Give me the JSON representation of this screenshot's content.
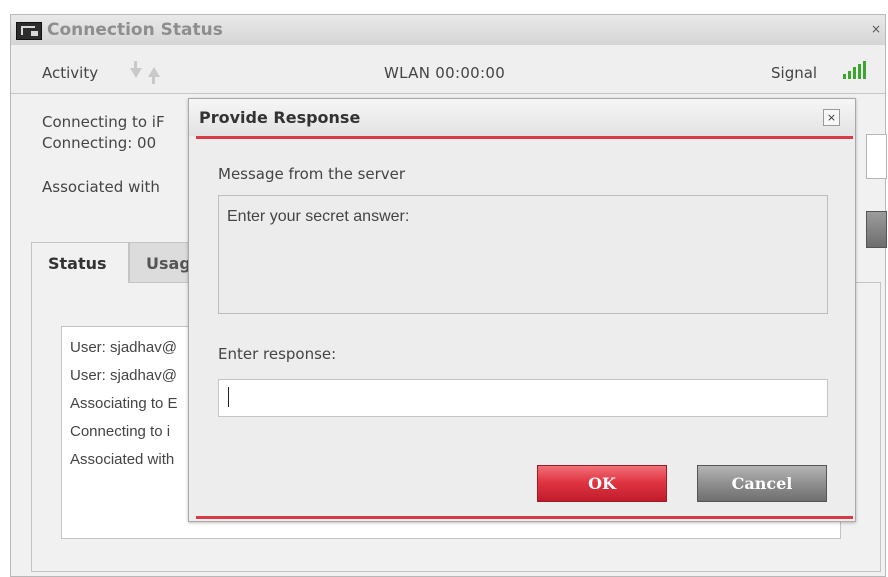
{
  "window": {
    "title": "Connection Status",
    "close_glyph": "×"
  },
  "topbar": {
    "activity_label": "Activity",
    "wlan_text": "WLAN  00:00:00",
    "signal_label": "Signal"
  },
  "background": {
    "line1": "Connecting to iF",
    "line2": "Connecting: 00",
    "line3": "Associated with",
    "tabs": [
      {
        "label": "Status"
      },
      {
        "label": "Usag"
      }
    ],
    "log_lines": [
      "User: sjadhav@",
      "User: sjadhav@",
      "Associating to E",
      "Connecting to i",
      "Associated with"
    ]
  },
  "dialog": {
    "title": "Provide Response",
    "close_glyph": "×",
    "message_label": "Message from the server",
    "message_text": "Enter your secret answer:",
    "response_label": "Enter response:",
    "response_value": "",
    "ok_label": "OK",
    "cancel_label": "Cancel"
  },
  "colors": {
    "accent_red": "#d93a47",
    "signal_green": "#3ba52f"
  }
}
